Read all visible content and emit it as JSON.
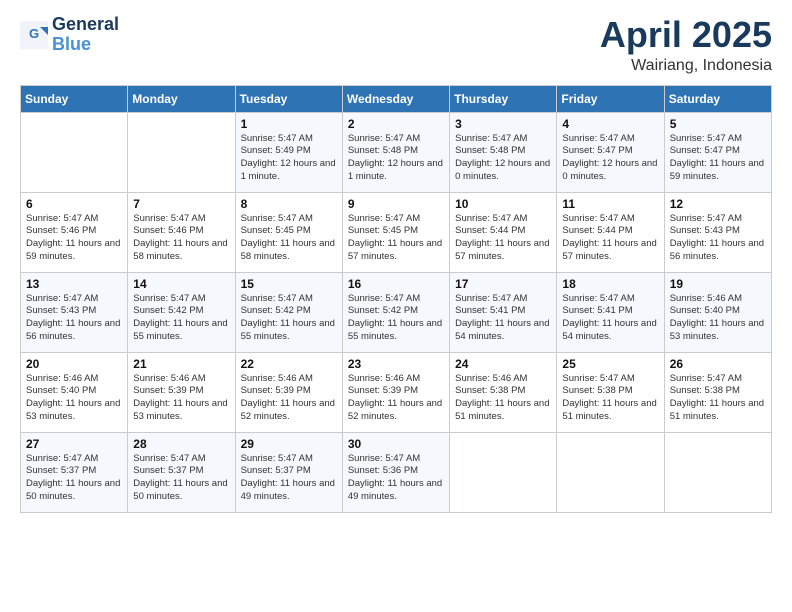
{
  "logo": {
    "line1": "General",
    "line2": "Blue"
  },
  "title": "April 2025",
  "subtitle": "Wairiang, Indonesia",
  "weekdays": [
    "Sunday",
    "Monday",
    "Tuesday",
    "Wednesday",
    "Thursday",
    "Friday",
    "Saturday"
  ],
  "weeks": [
    [
      {
        "day": null,
        "info": null
      },
      {
        "day": null,
        "info": null
      },
      {
        "day": "1",
        "info": "Sunrise: 5:47 AM\nSunset: 5:49 PM\nDaylight: 12 hours and 1 minute."
      },
      {
        "day": "2",
        "info": "Sunrise: 5:47 AM\nSunset: 5:48 PM\nDaylight: 12 hours and 1 minute."
      },
      {
        "day": "3",
        "info": "Sunrise: 5:47 AM\nSunset: 5:48 PM\nDaylight: 12 hours and 0 minutes."
      },
      {
        "day": "4",
        "info": "Sunrise: 5:47 AM\nSunset: 5:47 PM\nDaylight: 12 hours and 0 minutes."
      },
      {
        "day": "5",
        "info": "Sunrise: 5:47 AM\nSunset: 5:47 PM\nDaylight: 11 hours and 59 minutes."
      }
    ],
    [
      {
        "day": "6",
        "info": "Sunrise: 5:47 AM\nSunset: 5:46 PM\nDaylight: 11 hours and 59 minutes."
      },
      {
        "day": "7",
        "info": "Sunrise: 5:47 AM\nSunset: 5:46 PM\nDaylight: 11 hours and 58 minutes."
      },
      {
        "day": "8",
        "info": "Sunrise: 5:47 AM\nSunset: 5:45 PM\nDaylight: 11 hours and 58 minutes."
      },
      {
        "day": "9",
        "info": "Sunrise: 5:47 AM\nSunset: 5:45 PM\nDaylight: 11 hours and 57 minutes."
      },
      {
        "day": "10",
        "info": "Sunrise: 5:47 AM\nSunset: 5:44 PM\nDaylight: 11 hours and 57 minutes."
      },
      {
        "day": "11",
        "info": "Sunrise: 5:47 AM\nSunset: 5:44 PM\nDaylight: 11 hours and 57 minutes."
      },
      {
        "day": "12",
        "info": "Sunrise: 5:47 AM\nSunset: 5:43 PM\nDaylight: 11 hours and 56 minutes."
      }
    ],
    [
      {
        "day": "13",
        "info": "Sunrise: 5:47 AM\nSunset: 5:43 PM\nDaylight: 11 hours and 56 minutes."
      },
      {
        "day": "14",
        "info": "Sunrise: 5:47 AM\nSunset: 5:42 PM\nDaylight: 11 hours and 55 minutes."
      },
      {
        "day": "15",
        "info": "Sunrise: 5:47 AM\nSunset: 5:42 PM\nDaylight: 11 hours and 55 minutes."
      },
      {
        "day": "16",
        "info": "Sunrise: 5:47 AM\nSunset: 5:42 PM\nDaylight: 11 hours and 55 minutes."
      },
      {
        "day": "17",
        "info": "Sunrise: 5:47 AM\nSunset: 5:41 PM\nDaylight: 11 hours and 54 minutes."
      },
      {
        "day": "18",
        "info": "Sunrise: 5:47 AM\nSunset: 5:41 PM\nDaylight: 11 hours and 54 minutes."
      },
      {
        "day": "19",
        "info": "Sunrise: 5:46 AM\nSunset: 5:40 PM\nDaylight: 11 hours and 53 minutes."
      }
    ],
    [
      {
        "day": "20",
        "info": "Sunrise: 5:46 AM\nSunset: 5:40 PM\nDaylight: 11 hours and 53 minutes."
      },
      {
        "day": "21",
        "info": "Sunrise: 5:46 AM\nSunset: 5:39 PM\nDaylight: 11 hours and 53 minutes."
      },
      {
        "day": "22",
        "info": "Sunrise: 5:46 AM\nSunset: 5:39 PM\nDaylight: 11 hours and 52 minutes."
      },
      {
        "day": "23",
        "info": "Sunrise: 5:46 AM\nSunset: 5:39 PM\nDaylight: 11 hours and 52 minutes."
      },
      {
        "day": "24",
        "info": "Sunrise: 5:46 AM\nSunset: 5:38 PM\nDaylight: 11 hours and 51 minutes."
      },
      {
        "day": "25",
        "info": "Sunrise: 5:47 AM\nSunset: 5:38 PM\nDaylight: 11 hours and 51 minutes."
      },
      {
        "day": "26",
        "info": "Sunrise: 5:47 AM\nSunset: 5:38 PM\nDaylight: 11 hours and 51 minutes."
      }
    ],
    [
      {
        "day": "27",
        "info": "Sunrise: 5:47 AM\nSunset: 5:37 PM\nDaylight: 11 hours and 50 minutes."
      },
      {
        "day": "28",
        "info": "Sunrise: 5:47 AM\nSunset: 5:37 PM\nDaylight: 11 hours and 50 minutes."
      },
      {
        "day": "29",
        "info": "Sunrise: 5:47 AM\nSunset: 5:37 PM\nDaylight: 11 hours and 49 minutes."
      },
      {
        "day": "30",
        "info": "Sunrise: 5:47 AM\nSunset: 5:36 PM\nDaylight: 11 hours and 49 minutes."
      },
      {
        "day": null,
        "info": null
      },
      {
        "day": null,
        "info": null
      },
      {
        "day": null,
        "info": null
      }
    ]
  ]
}
